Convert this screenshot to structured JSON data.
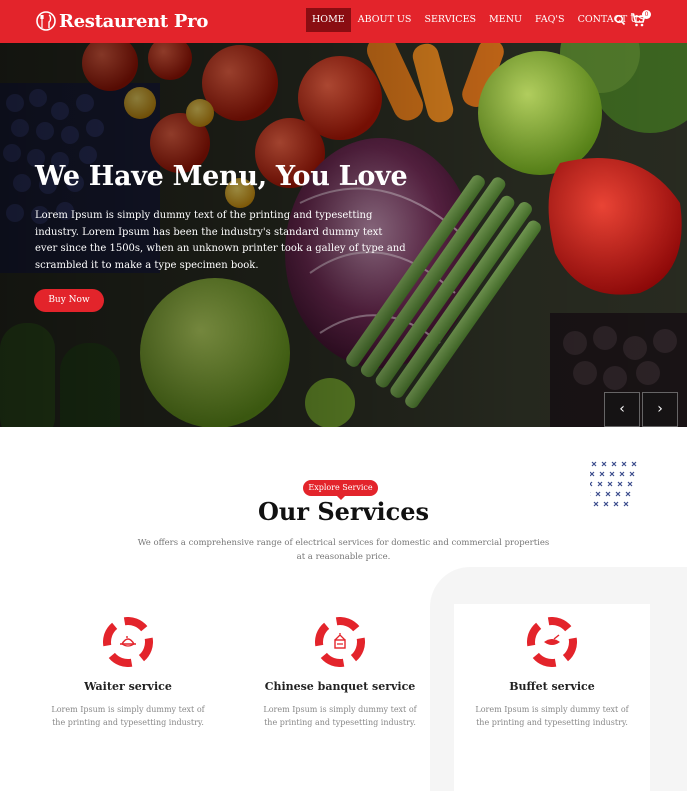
{
  "brand": {
    "name": "Restaurent Pro"
  },
  "nav": {
    "items": [
      {
        "label": "HOME",
        "active": true
      },
      {
        "label": "ABOUT US",
        "active": false
      },
      {
        "label": "SERVICES",
        "active": false
      },
      {
        "label": "MENU",
        "active": false
      },
      {
        "label": "FAQ'S",
        "active": false
      },
      {
        "label": "CONTACT US",
        "active": false
      }
    ],
    "search_icon": "search-icon",
    "cart_icon": "cart-icon",
    "cart_count": "0"
  },
  "hero": {
    "title": "We Have Menu, You Love",
    "description": "Lorem Ipsum is simply dummy text of the printing and typesetting industry. Lorem Ipsum has been the industry's standard dummy text ever since the 1500s, when an unknown printer took a galley of type and scrambled it to make a type specimen book.",
    "button_label": "Buy Now",
    "prev_label": "‹",
    "next_label": "›"
  },
  "services": {
    "tag": "Explore Service",
    "title": "Our Services",
    "description": "We offers a comprehensive range of electrical services for domestic and commercial properties at a reasonable price.",
    "cards": [
      {
        "title": "Waiter service",
        "description": "Lorem Ipsum is simply dummy text of the printing and typesetting industry.",
        "icon": "waiter-icon"
      },
      {
        "title": "Chinese banquet service",
        "description": "Lorem Ipsum is simply dummy text of the printing and typesetting industry.",
        "icon": "banquet-icon"
      },
      {
        "title": "Buffet service",
        "description": "Lorem Ipsum is simply dummy text of the printing and typesetting industry.",
        "icon": "buffet-icon"
      }
    ]
  },
  "colors": {
    "primary": "#e3242b",
    "active_nav": "#8a0d12",
    "text_dark": "#222222",
    "text_muted": "#888888"
  }
}
